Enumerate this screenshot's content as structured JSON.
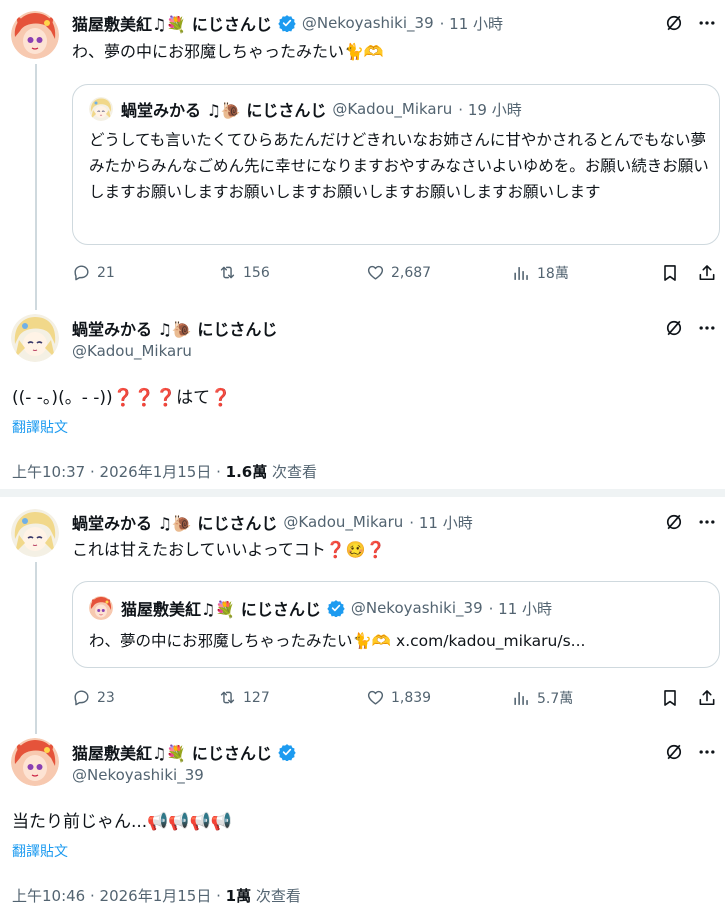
{
  "tweet1": {
    "name": "猫屋敷美紅♫💐 にじさんじ",
    "handle": "@Nekoyashiki_39",
    "time": "· 11 小時",
    "text": "わ、夢の中にお邪魔しちゃったみたい🐈🫶",
    "quote": {
      "name": "蝸堂みかる ♫🐌 にじさんじ",
      "handle": "@Kadou_Mikaru",
      "time": "· 19 小時",
      "text": "どうしても言いたくてひらあたんだけどきれいなお姉さんに甘やかされるとんでもない夢みたからみんなごめん先に幸せになりますおやすみなさいよいゆめを。お願い続きお願いしますお願いしますお願いしますお願いしますお願いしますお願いします"
    },
    "actions": {
      "replies": "21",
      "retweets": "156",
      "likes": "2,687",
      "views": "18萬"
    }
  },
  "tweet2": {
    "name": "蝸堂みかる ♫🐌 にじさんじ",
    "handle": "@Kadou_Mikaru",
    "text": "((- -。)(。- -))❓❓❓はて❓",
    "translate": "翻譯貼文",
    "meta_time": "上午10:37 · 2026年1月15日 · ",
    "meta_views": "1.6萬",
    "meta_suffix": " 次查看"
  },
  "tweet3": {
    "name": "蝸堂みかる ♫🐌 にじさんじ",
    "handle": "@Kadou_Mikaru",
    "time": "· 11 小時",
    "text": "これは甘えたおしていいよってコト❓🥴❓",
    "quote": {
      "name": "猫屋敷美紅♫💐 にじさんじ",
      "handle": "@Nekoyashiki_39",
      "time": "· 11 小時",
      "text": "わ、夢の中にお邪魔しちゃったみたい🐈🫶 x.com/kadou_mikaru/s..."
    },
    "actions": {
      "replies": "23",
      "retweets": "127",
      "likes": "1,839",
      "views": "5.7萬"
    }
  },
  "tweet4": {
    "name": "猫屋敷美紅♫💐 にじさんじ",
    "handle": "@Nekoyashiki_39",
    "text": "当たり前じゃん...📢📢📢📢",
    "translate": "翻譯貼文",
    "meta_time": "上午10:46 · 2026年1月15日 · ",
    "meta_views": "1萬",
    "meta_suffix": " 次查看"
  },
  "icons": {
    "grok": "grok-icon",
    "more": "more-icon",
    "reply": "reply-icon",
    "retweet": "retweet-icon",
    "like": "like-icon",
    "views": "views-icon",
    "bookmark": "bookmark-icon",
    "share": "share-icon",
    "verified": "verified-badge-icon"
  },
  "colors": {
    "accent": "#1d9bf0",
    "muted": "#536471",
    "text": "#0f1419",
    "border": "#cfd9de"
  }
}
